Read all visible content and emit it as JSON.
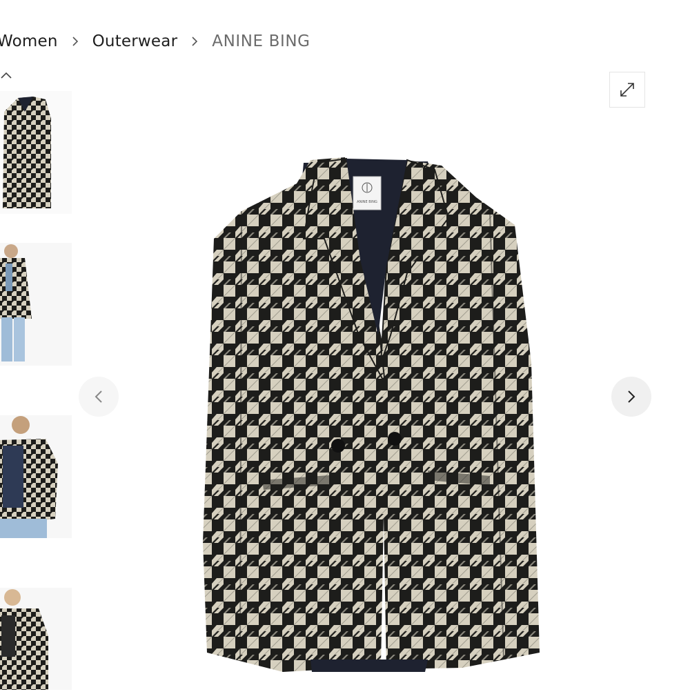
{
  "breadcrumb": {
    "items": [
      {
        "label": "Women"
      },
      {
        "label": "Outerwear"
      },
      {
        "label": "ANINE BING"
      }
    ],
    "separator_icon": "chevron-right-icon"
  },
  "gallery": {
    "thumbnails": [
      {
        "alt": "Houndstooth blazer front view"
      },
      {
        "alt": "Model wearing blazer with jeans"
      },
      {
        "alt": "Model wearing blazer over graphic tee"
      },
      {
        "alt": "Blazer detail view"
      }
    ],
    "main_image_alt": "ANINE BING houndstooth double-breasted blazer",
    "label_logo_text": "ANINE BING",
    "icons": {
      "scroll_up": "chevron-up-icon",
      "expand": "expand-arrows-icon",
      "prev": "chevron-left-icon",
      "next": "chevron-right-icon"
    }
  },
  "colors": {
    "houndstooth_dark": "#1c1c1a",
    "houndstooth_light": "#d6d0bf",
    "lining": "#1e2230"
  }
}
